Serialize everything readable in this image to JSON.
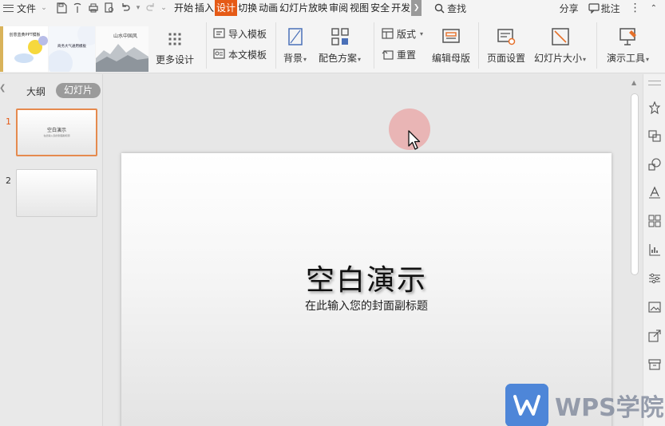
{
  "menubar": {
    "file_label": "文件",
    "tabs": [
      "开始",
      "插入",
      "设计",
      "切换",
      "动画",
      "幻灯片放映",
      "审阅",
      "视图",
      "安全",
      "开发"
    ],
    "active_tab": "设计",
    "search_label": "查找",
    "share_label": "分享",
    "comment_label": "批注"
  },
  "ribbon": {
    "template_thumbs": [
      {
        "text": "创意蓝黄PPT模板"
      },
      {
        "text": "商务大气通用模板"
      },
      {
        "text": "山水中国风"
      }
    ],
    "more_design_label": "更多设计",
    "import_template_label": "导入模板",
    "this_template_label": "本文模板",
    "background_label": "背景",
    "color_scheme_label": "配色方案",
    "layout_label": "版式",
    "reset_label": "重置",
    "edit_master_label": "编辑母版",
    "page_setup_label": "页面设置",
    "slide_size_label": "幻灯片大小",
    "presentation_tools_label": "演示工具"
  },
  "left_panel": {
    "outline_tab": "大纲",
    "slides_tab": "幻灯片",
    "thumbnails": [
      {
        "number": "1",
        "title": "空白演示",
        "subtitle": "在此输入您的封面副标题",
        "active": true
      },
      {
        "number": "2",
        "title": "",
        "subtitle": "",
        "active": false
      }
    ]
  },
  "slide": {
    "title": "空白演示",
    "subtitle": "在此输入您的封面副标题"
  },
  "watermark": {
    "text": "WPS学院"
  },
  "colors": {
    "accent": "#e55a16",
    "wps_blue": "#4e86d8"
  }
}
